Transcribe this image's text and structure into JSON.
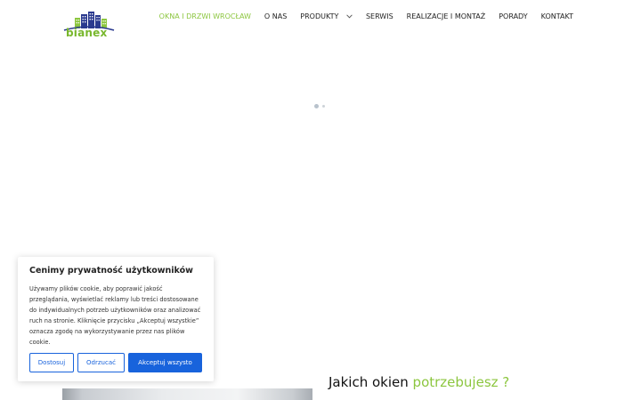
{
  "header": {
    "logo_text": "bianex",
    "nav": [
      {
        "label": "OKNA I DRZWI WROCŁAW",
        "active": true
      },
      {
        "label": "O NAS",
        "active": false
      },
      {
        "label": "PRODUKTY",
        "active": false,
        "has_dropdown": true
      },
      {
        "label": "SERWIS",
        "active": false
      },
      {
        "label": "REALIZACJE I MONTAŻ",
        "active": false
      },
      {
        "label": "PORADY",
        "active": false
      },
      {
        "label": "KONTAKT",
        "active": false
      }
    ]
  },
  "colors": {
    "accent_green": "#8cc63f",
    "logo_blue": "#2b3a8f",
    "button_blue": "#1863dc"
  },
  "section": {
    "heading_prefix": "Jakich okien",
    "heading_accent": "potrzebujesz ?"
  },
  "cookie_banner": {
    "title": "Cenimy prywatność użytkowników",
    "text": "Używamy plików cookie, aby poprawić jakość przeglądania, wyświetlać reklamy lub treści dostosowane do indywidualnych potrzeb użytkowników oraz analizować ruch na stronie. Kliknięcie przycisku „Akceptuj wszystkie” oznacza zgodę na wykorzystywanie przez nas plików cookie.",
    "buttons": {
      "customize": "Dostosuj",
      "reject": "Odrzucać",
      "accept": "Akceptuj wszysto"
    }
  },
  "icons": {
    "logo": "bianex-buildings-logo",
    "dropdown": "chevron-down-icon"
  }
}
